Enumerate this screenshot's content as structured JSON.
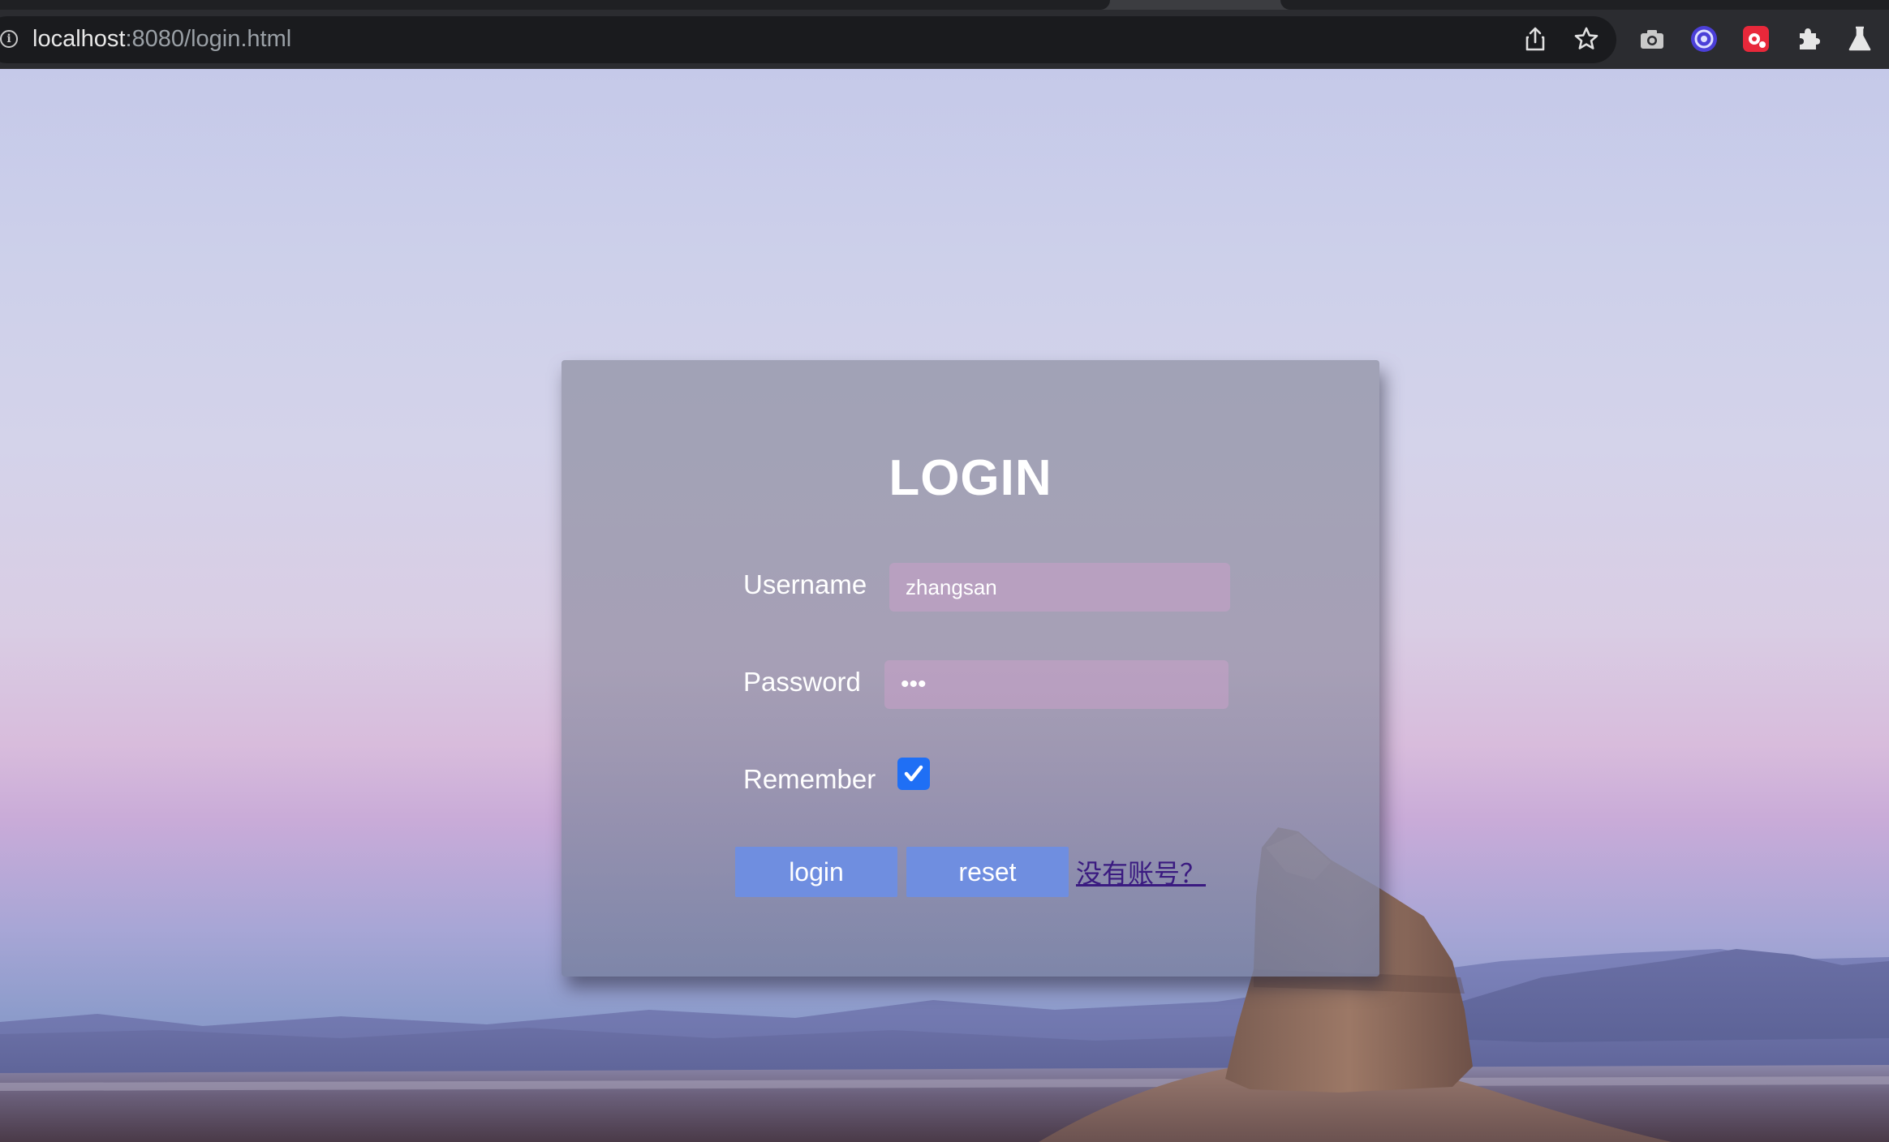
{
  "browser": {
    "url_host": "localhost",
    "url_rest": ":8080/login.html",
    "icons": [
      "info-icon",
      "share-icon",
      "bookmark-star-icon",
      "camera-extension-icon",
      "email-extension-icon",
      "red-extension-icon",
      "extensions-puzzle-icon",
      "labs-flask-icon"
    ]
  },
  "login": {
    "title": "LOGIN",
    "username_label": "Username",
    "username_value": "zhangsan",
    "password_label": "Password",
    "password_value": "•••",
    "remember_label": "Remember",
    "remember_checked": true,
    "login_button": "login",
    "reset_button": "reset",
    "register_link": "没有账号？"
  },
  "colors": {
    "card_overlay": "#9a9aae",
    "button": "#6f8ee0",
    "checkbox": "#1f6ff5",
    "link": "#3a1a80"
  }
}
